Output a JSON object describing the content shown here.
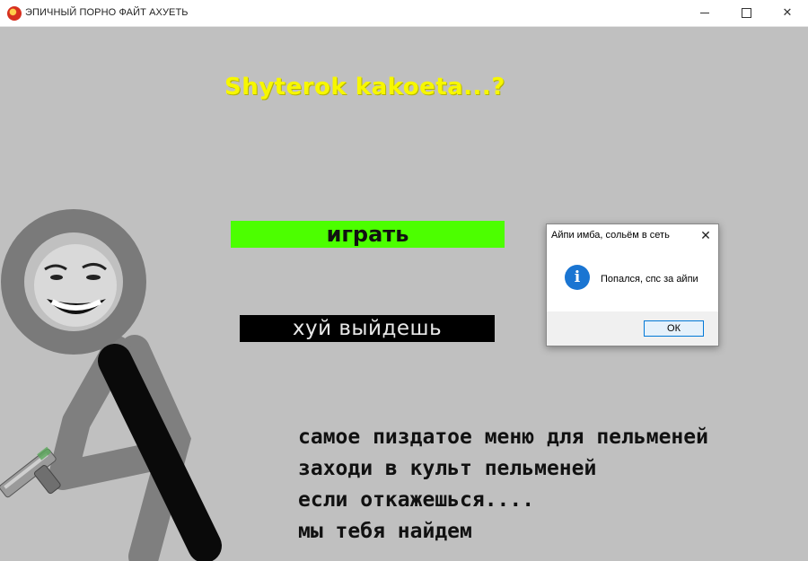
{
  "window": {
    "title": "ЭПИЧНЫЙ ПОРНО ФАЙТ АХУЕТЬ",
    "icon": "app-icon",
    "controls": [
      "minimize",
      "maximize",
      "close"
    ]
  },
  "menu": {
    "title": "Shyterok kakoeta...?",
    "play_label": "играть",
    "exit_label": "хуй выйдешь",
    "lines": [
      "самое пиздатое меню для пельменей",
      "заходи в культ пельменей",
      "если откажешься....",
      "мы тебя найдем"
    ]
  },
  "dialog": {
    "title": "Айпи имба, сольём в сеть",
    "message": "Попался, спс за айпи",
    "icon": "info-icon",
    "ok_label": "ОК",
    "close_glyph": "✕"
  },
  "colors": {
    "background": "#c0c0c0",
    "title_yellow": "#f7f700",
    "play_green": "#4cff00",
    "exit_black": "#000000"
  }
}
